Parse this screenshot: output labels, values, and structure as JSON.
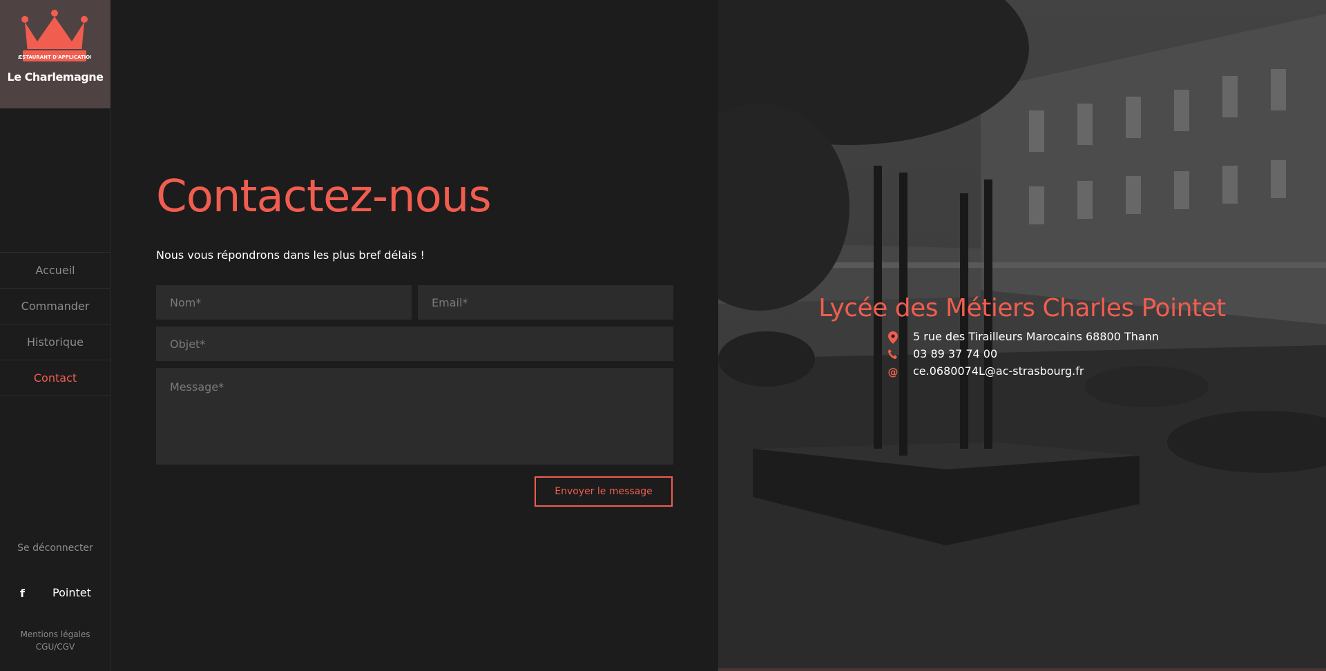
{
  "brand": {
    "badge_text": "RESTAURANT D'APPLICATION",
    "name": "Le Charlemagne"
  },
  "nav": {
    "items": [
      {
        "label": "Accueil",
        "active": false
      },
      {
        "label": "Commander",
        "active": false
      },
      {
        "label": "Historique",
        "active": false
      },
      {
        "label": "Contact",
        "active": true
      }
    ]
  },
  "sidebar_footer": {
    "logout": "Se déconnecter",
    "facebook_icon": "facebook-icon",
    "facebook_label": "Pointet",
    "legal": "Mentions légales",
    "terms": "CGU/CGV"
  },
  "contact": {
    "title": "Contactez-nous",
    "subtitle": "Nous vous répondrons dans les plus bref délais !",
    "name_placeholder": "Nom*",
    "email_placeholder": "Email*",
    "subject_placeholder": "Objet*",
    "message_placeholder": "Message*",
    "submit_label": "Envoyer le message"
  },
  "school": {
    "name": "Lycée des Métiers Charles Pointet",
    "address": "5 rue des Tirailleurs Marocains 68800 Thann",
    "phone": "03 89 37 74 00",
    "email": "ce.0680074L@ac-strasbourg.fr",
    "icons": [
      "map-pin-icon",
      "phone-icon",
      "at-icon"
    ]
  },
  "colors": {
    "accent": "#f15d4f",
    "background": "#1c1c1d",
    "field_bg": "#2c2c2d",
    "logo_bg": "#4f4242"
  }
}
